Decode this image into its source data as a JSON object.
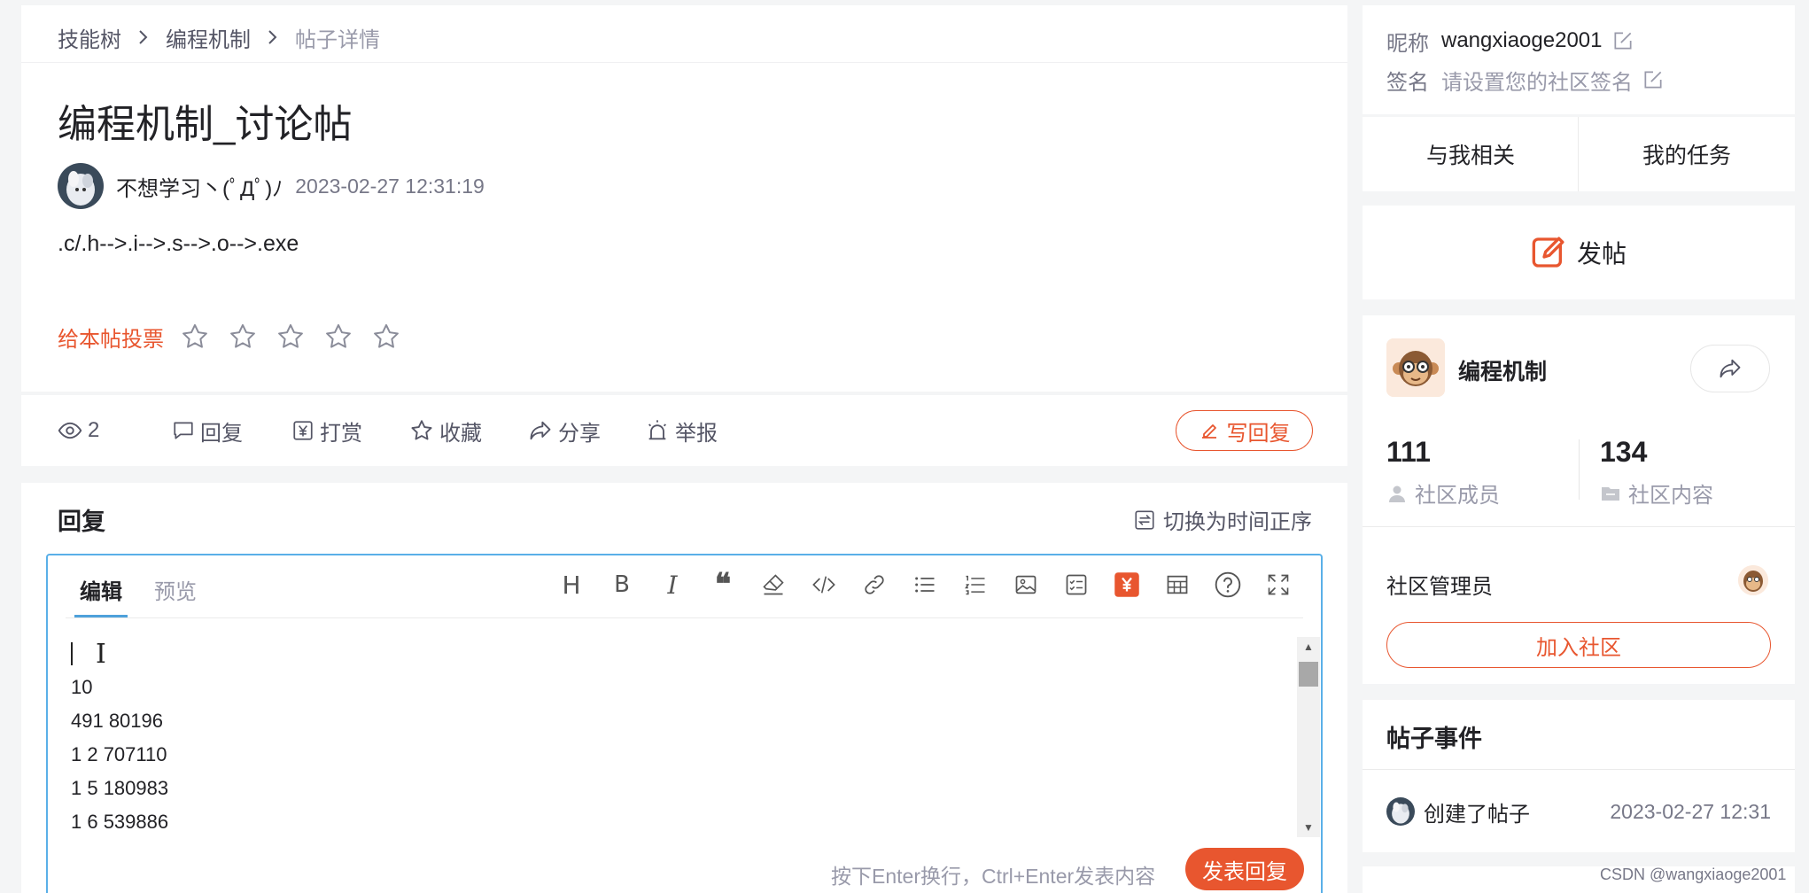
{
  "breadcrumb": {
    "items": [
      "技能树",
      "编程机制",
      "帖子详情"
    ]
  },
  "post": {
    "title": "编程机制_讨论帖",
    "author": "不想学习丶(ﾟДﾟ)ﾉ",
    "time": "2023-02-27 12:31:19",
    "body": ".c/.h-->.i-->.s-->.o-->.exe",
    "vote_label": "给本帖投票",
    "rating": 0,
    "rating_max": 5
  },
  "actions": {
    "views": "2",
    "reply": "回复",
    "reward": "打赏",
    "favorite": "收藏",
    "share": "分享",
    "report": "举报",
    "write_reply": "写回复"
  },
  "reply_section": {
    "title": "回复",
    "sort_toggle": "切换为时间正序",
    "editor_tabs": [
      "编辑",
      "预览"
    ],
    "active_tab": "编辑",
    "toolbar_icons": [
      "heading-icon",
      "bold-icon",
      "italic-icon",
      "quote-icon",
      "clear-format-icon",
      "code-icon",
      "link-icon",
      "bullet-list-icon",
      "ordered-list-icon",
      "image-icon",
      "task-list-icon",
      "reward-icon",
      "table-icon",
      "help-icon",
      "fullscreen-icon"
    ],
    "content_lines": [
      "10",
      "491 80196",
      "1 2 707110",
      "1 5 180983",
      "1 6 539886"
    ],
    "hint": "按下Enter换行，Ctrl+Enter发表内容",
    "submit": "发表回复"
  },
  "profile": {
    "nickname_label": "昵称",
    "nickname": "wangxiaoge2001",
    "signature_label": "签名",
    "signature_placeholder": "请设置您的社区签名"
  },
  "right_tabs": [
    "与我相关",
    "我的任务"
  ],
  "post_button": "发帖",
  "community": {
    "name": "编程机制",
    "members_count": "111",
    "members_label": "社区成员",
    "content_count": "134",
    "content_label": "社区内容",
    "admin_label": "社区管理员",
    "join": "加入社区"
  },
  "events": {
    "title": "帖子事件",
    "items": [
      {
        "text": "创建了帖子",
        "time": "2023-02-27 12:31"
      }
    ]
  },
  "watermark": "CSDN @wangxiaoge2001",
  "colors": {
    "accent": "#e8562f",
    "editor_border": "#5ab0e8",
    "background": "#f4f5f6"
  }
}
